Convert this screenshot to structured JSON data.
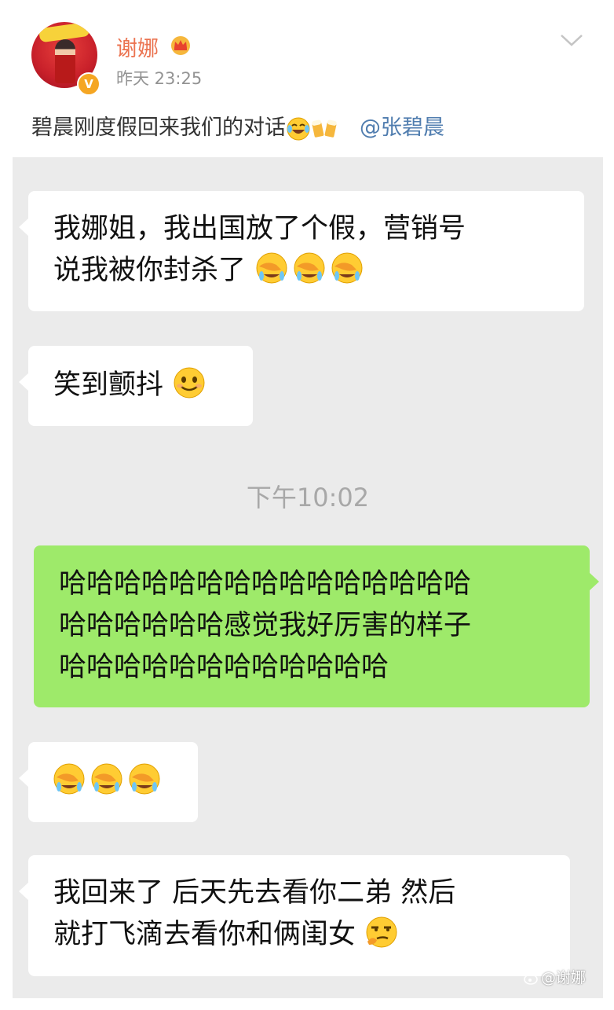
{
  "post": {
    "username": "谢娜",
    "time": "昨天 23:25",
    "text": "碧晨刚度假回来我们的对话",
    "mention": "@张碧晨",
    "inline_icons": [
      "laughing-tears-emoji",
      "beer-cheers-emoji"
    ]
  },
  "chat": {
    "messages": [
      {
        "side": "left",
        "text": "我娜姐，我出国放了个假，营销号说我被你封杀了",
        "emojis": [
          "facepalm-cry-emoji",
          "facepalm-cry-emoji",
          "facepalm-cry-emoji"
        ]
      },
      {
        "side": "left",
        "text": "笑到颤抖",
        "emojis": [
          "smile-emoji"
        ]
      },
      {
        "side": "right",
        "text": "哈哈哈哈哈哈哈哈哈哈哈哈哈哈哈哈哈哈哈哈哈哈感觉我好厉害的样子哈哈哈哈哈哈哈哈哈哈哈哈"
      },
      {
        "side": "left",
        "text": "",
        "emojis": [
          "facepalm-cry-emoji",
          "facepalm-cry-emoji",
          "facepalm-cry-emoji"
        ]
      },
      {
        "side": "left",
        "text": "我回来了 后天先去看你二弟 然后就打飞滴去看你和俩闺女",
        "emojis": [
          "smug-thinking-emoji"
        ]
      }
    ],
    "timestamp": "下午10:02",
    "lines": {
      "m1_l1": "我娜姐，我出国放了个假，营销号",
      "m1_l2": "说我被你封杀了",
      "m2": "笑到颤抖",
      "m3_l1": "哈哈哈哈哈哈哈哈哈哈哈哈哈哈哈",
      "m3_l2": "哈哈哈哈哈哈感觉我好厉害的样子",
      "m3_l3": "哈哈哈哈哈哈哈哈哈哈哈哈",
      "m5_l1": "我回来了 后天先去看你二弟 然后",
      "m5_l2": "就打飞滴去看你和俩闺女"
    }
  },
  "watermark": "@谢娜",
  "colors": {
    "username": "#eb7350",
    "mention": "#507daf",
    "chat_bg": "#ebebeb",
    "bubble_self": "#9eea6a",
    "bubble_other": "#ffffff"
  }
}
